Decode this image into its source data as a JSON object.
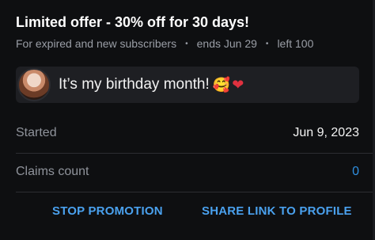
{
  "offer": {
    "title": "Limited offer - 30% off for 30 days!",
    "audience": "For expired and new subscribers",
    "ends": "ends Jun 29",
    "left": "left 100",
    "separator": "•"
  },
  "message": {
    "text": "It’s my birthday month!",
    "emoji_1": "🥰",
    "emoji_2": "❤"
  },
  "details": {
    "started_label": "Started",
    "started_value": "Jun 9, 2023",
    "claims_label": "Claims count",
    "claims_value": "0"
  },
  "actions": {
    "stop": "STOP PROMOTION",
    "share": "SHARE LINK TO PROFILE"
  },
  "colors": {
    "background": "#0e0f11",
    "accent": "#4aa1ee",
    "muted": "#9a9ea6"
  }
}
